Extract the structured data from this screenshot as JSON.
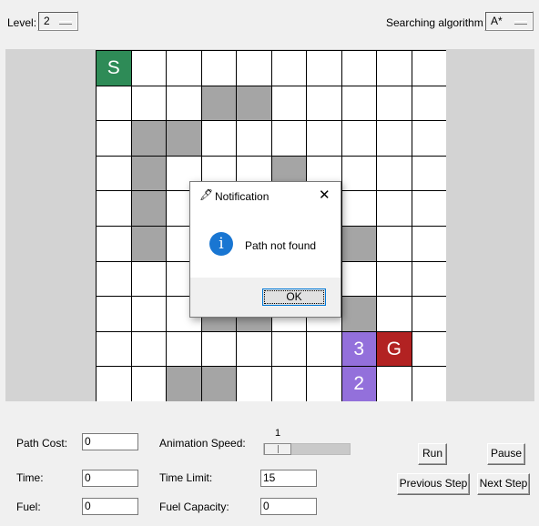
{
  "top": {
    "level_label": "Level:",
    "level_value": "2",
    "algo_label": "Searching algorithm:",
    "algo_value": "A*"
  },
  "grid": {
    "rows": 10,
    "cols": 10,
    "walls": [
      [
        2,
        4
      ],
      [
        2,
        5
      ],
      [
        3,
        2
      ],
      [
        3,
        3
      ],
      [
        4,
        2
      ],
      [
        4,
        6
      ],
      [
        5,
        2
      ],
      [
        6,
        2
      ],
      [
        6,
        7
      ],
      [
        6,
        8
      ],
      [
        8,
        4
      ],
      [
        8,
        5
      ],
      [
        8,
        8
      ],
      [
        10,
        3
      ],
      [
        10,
        4
      ]
    ],
    "labels": [
      {
        "row": 1,
        "col": 1,
        "text": "S",
        "kind": "start"
      },
      {
        "row": 9,
        "col": 8,
        "text": "3",
        "kind": "step"
      },
      {
        "row": 9,
        "col": 9,
        "text": "G",
        "kind": "goal"
      },
      {
        "row": 10,
        "col": 8,
        "text": "2",
        "kind": "step"
      }
    ]
  },
  "dialog": {
    "title": "Notification",
    "message": "Path not found",
    "ok": "OK"
  },
  "controls": {
    "path_cost_label": "Path Cost:",
    "path_cost_value": "0",
    "time_label": "Time:",
    "time_value": "0",
    "fuel_label": "Fuel:",
    "fuel_value": "0",
    "anim_speed_label": "Animation Speed:",
    "anim_speed_value": "1",
    "anim_speed_fraction": 0.0,
    "time_limit_label": "Time Limit:",
    "time_limit_value": "15",
    "fuel_capacity_label": "Fuel Capacity:",
    "fuel_capacity_value": "0",
    "run_label": "Run",
    "pause_label": "Pause",
    "prev_step_label": "Previous Step",
    "next_step_label": "Next Step"
  },
  "colors": {
    "start": "#2e8b57",
    "goal": "#b22222",
    "step": "#9370db",
    "wall": "#a5a5a5",
    "info_icon": "#1976d2"
  }
}
